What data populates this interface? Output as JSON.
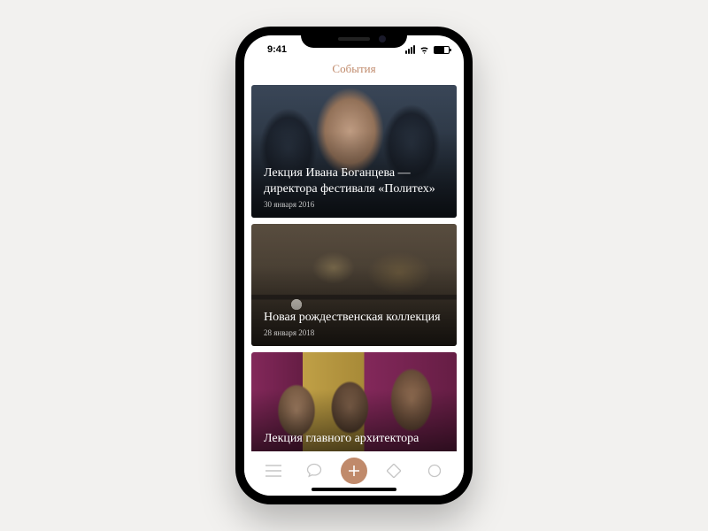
{
  "status": {
    "time": "9:41"
  },
  "header": {
    "title": "События"
  },
  "cards": [
    {
      "title": "Лекция Ивана Боганцева — директора фестиваля «Политех»",
      "date": "30 января 2016"
    },
    {
      "title": "Новая рождественская коллекция",
      "date": "28 января 2018"
    },
    {
      "title": "Лекция главного архитектора",
      "date": ""
    }
  ]
}
